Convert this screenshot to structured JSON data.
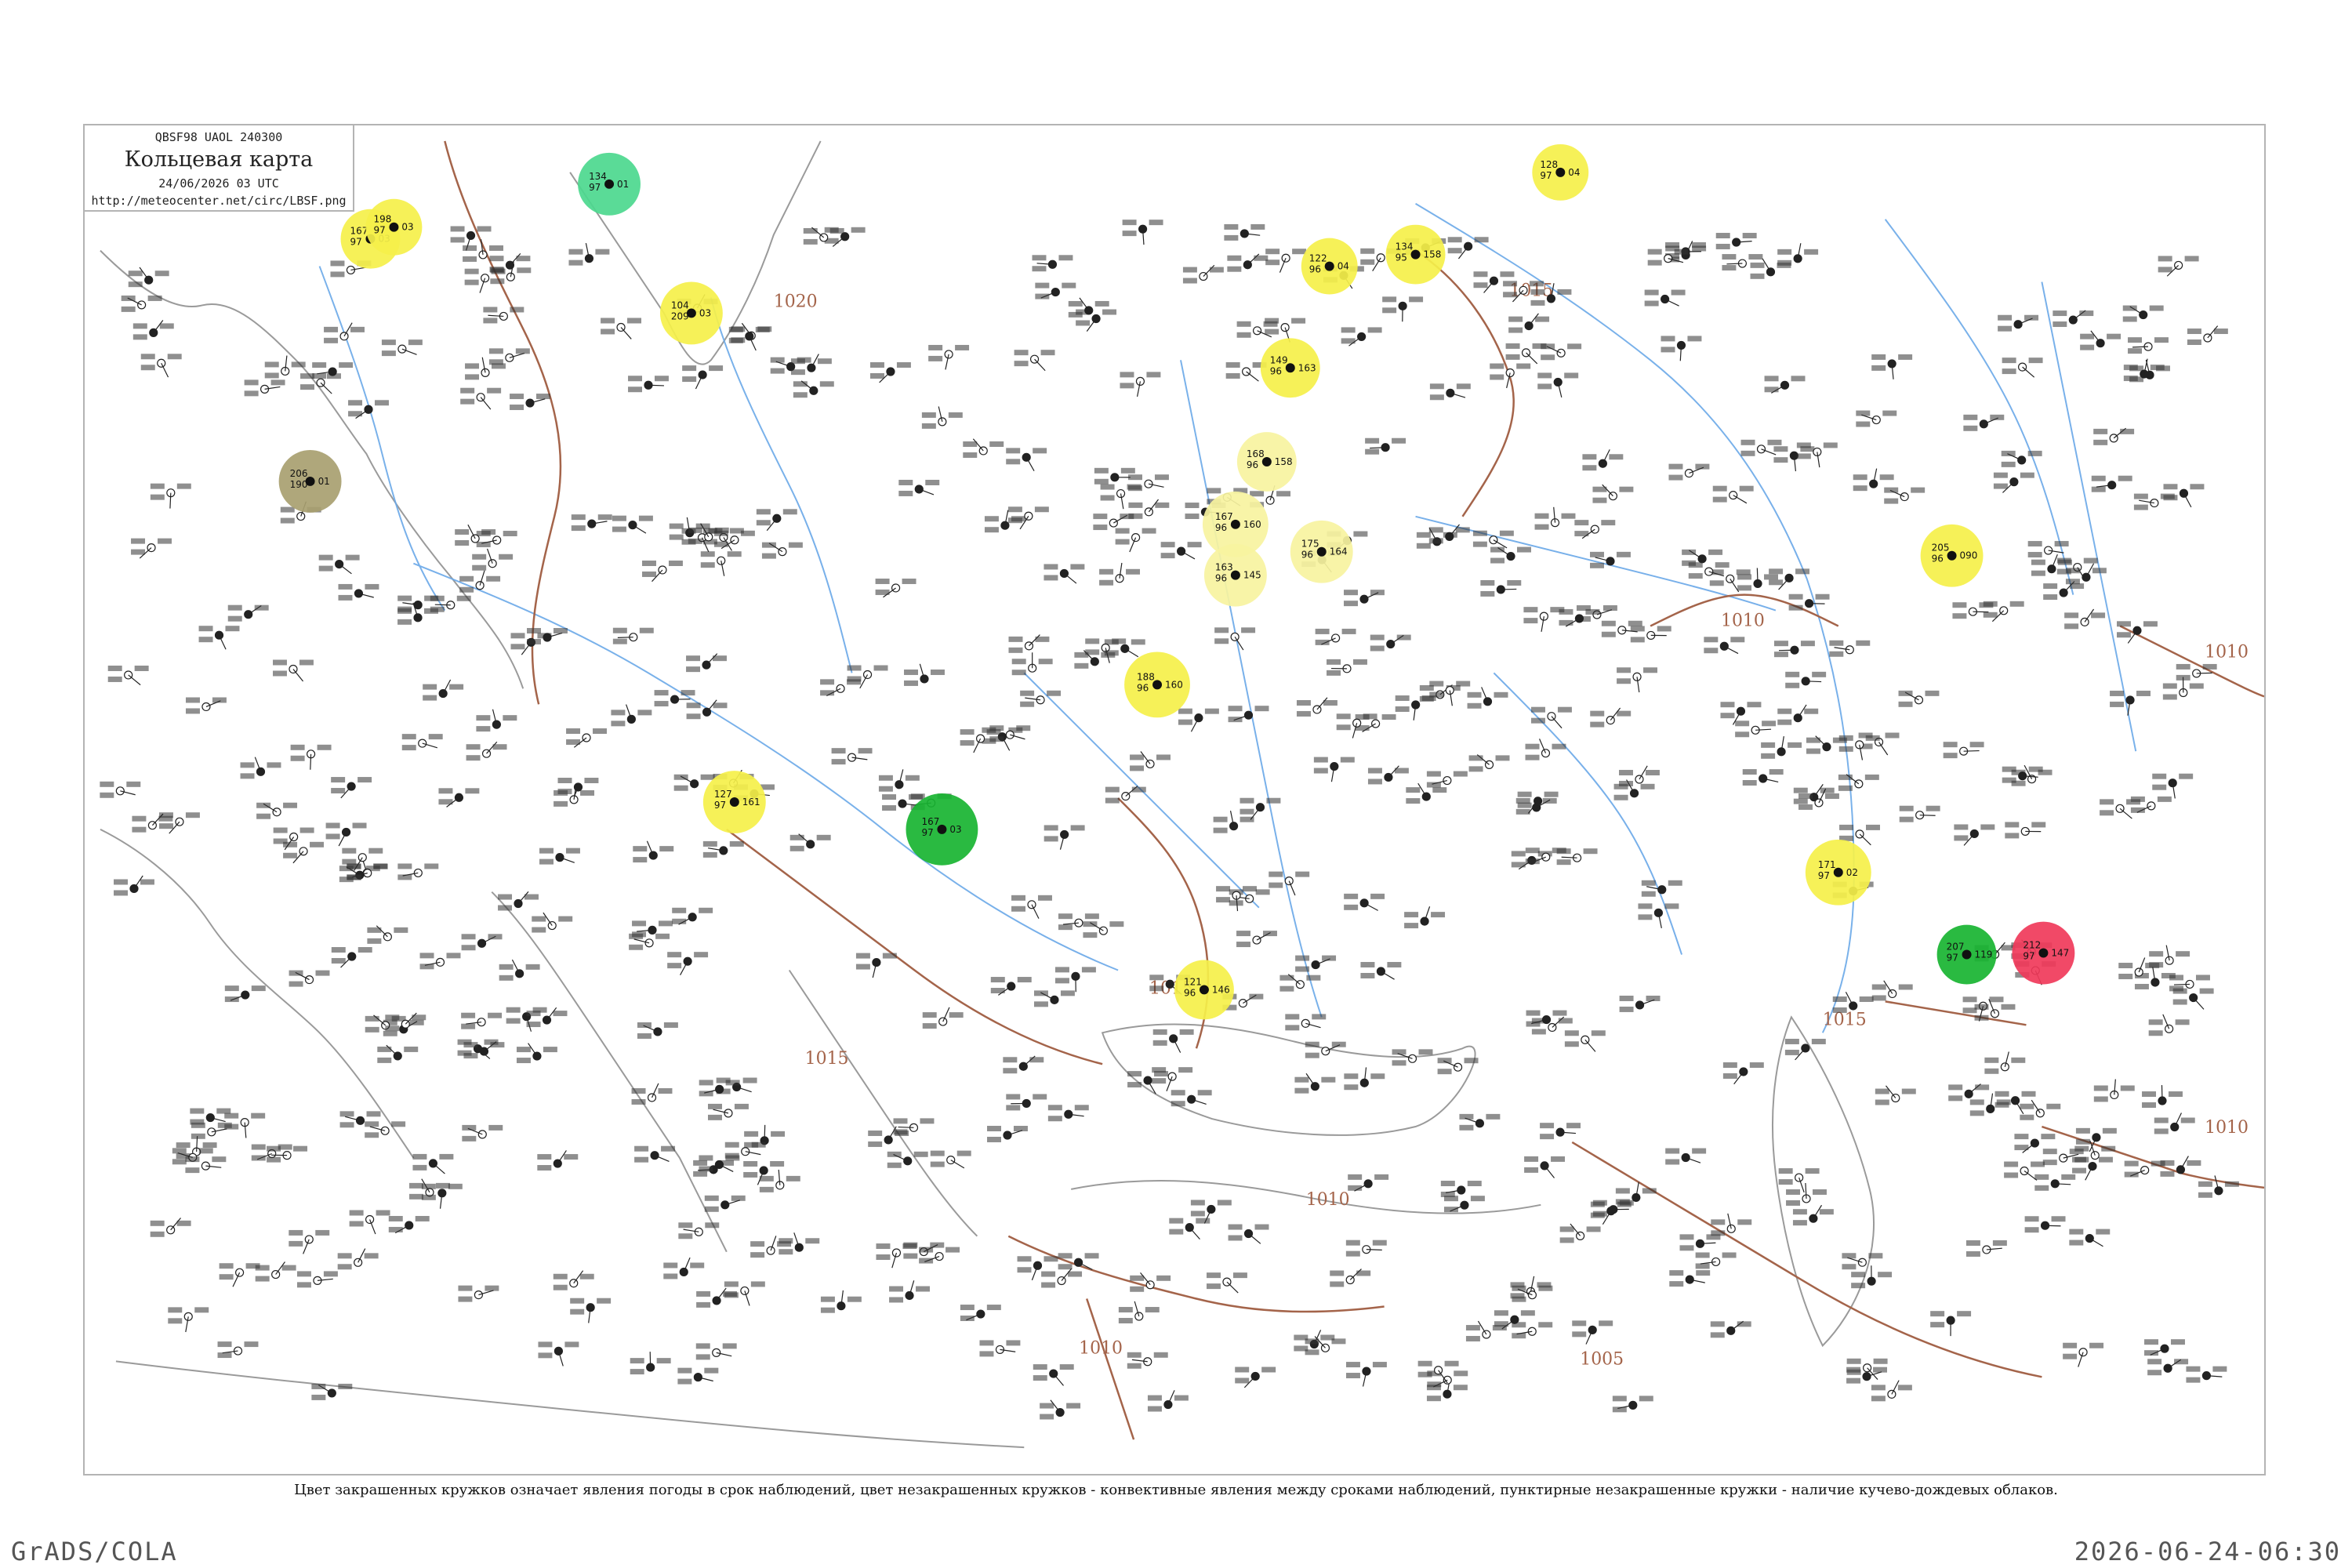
{
  "header": {
    "code": "QBSF98 UAOL 240300",
    "title": "Кольцевая карта",
    "time": "24/06/2026 03 UTC",
    "url": "http://meteocenter.net/circ/LBSF.png"
  },
  "isobars": [
    {
      "label": "1020"
    },
    {
      "label": "1015"
    },
    {
      "label": "1015"
    },
    {
      "label": "1015"
    },
    {
      "label": "1010"
    },
    {
      "label": "1010"
    },
    {
      "label": "1010"
    },
    {
      "label": "1010"
    },
    {
      "label": "1005"
    },
    {
      "label": "1010"
    },
    {
      "label": "1015"
    }
  ],
  "colors": {
    "isobar": "#a4644a",
    "river": "#6aa8e8",
    "coast": "#9a9a9a",
    "yellow": "#f5f04a",
    "pale_yellow": "#f7f3a0",
    "green": "#18b431",
    "mint": "#4cd88e",
    "red": "#f03a5a",
    "olive": "#a8a070"
  },
  "stations": [
    {
      "p": "167",
      "t": "97",
      "d": "03",
      "color": "yellow"
    },
    {
      "p": "198",
      "t": "97",
      "d": "03",
      "color": "yellow"
    },
    {
      "p": "134",
      "t": "97",
      "d": "01",
      "color": "mint"
    },
    {
      "p": "104",
      "t": "209",
      "d": "03",
      "color": "yellow"
    },
    {
      "p": "206",
      "t": "190",
      "d": "01",
      "color": "olive"
    },
    {
      "p": "127",
      "t": "97",
      "d": "161",
      "color": "yellow"
    },
    {
      "p": "167",
      "t": "97",
      "d": "03",
      "color": "green"
    },
    {
      "p": "128",
      "t": "97",
      "d": "04",
      "color": "yellow"
    },
    {
      "p": "134",
      "t": "95",
      "d": "158",
      "color": "yellow"
    },
    {
      "p": "122",
      "t": "96",
      "d": "04",
      "color": "yellow"
    },
    {
      "p": "149",
      "t": "96",
      "d": "163",
      "color": "yellow"
    },
    {
      "p": "168",
      "t": "96",
      "d": "158",
      "color": "pale_yellow"
    },
    {
      "p": "167",
      "t": "96",
      "d": "160",
      "color": "pale_yellow"
    },
    {
      "p": "163",
      "t": "96",
      "d": "145",
      "color": "pale_yellow"
    },
    {
      "p": "175",
      "t": "96",
      "d": "164",
      "color": "pale_yellow"
    },
    {
      "p": "188",
      "t": "96",
      "d": "160",
      "color": "yellow"
    },
    {
      "p": "121",
      "t": "96",
      "d": "146",
      "color": "yellow"
    },
    {
      "p": "205",
      "t": "96",
      "d": "090",
      "color": "yellow"
    },
    {
      "p": "171",
      "t": "97",
      "d": "02",
      "color": "yellow"
    },
    {
      "p": "207",
      "t": "97",
      "d": "119",
      "color": "green"
    },
    {
      "p": "212",
      "t": "97",
      "d": "147",
      "color": "red"
    }
  ],
  "footer": {
    "caption": "Цвет закрашенных кружков означает явления погоды в срок наблюдений, цвет незакрашенных кружков - конвективные явления между сроками наблюдений, пунктирные незакрашенные кружки - наличие кучево-дождевых облаков.",
    "grads": "GrADS/COLA",
    "timestamp": "2026-06-24-06:30"
  }
}
